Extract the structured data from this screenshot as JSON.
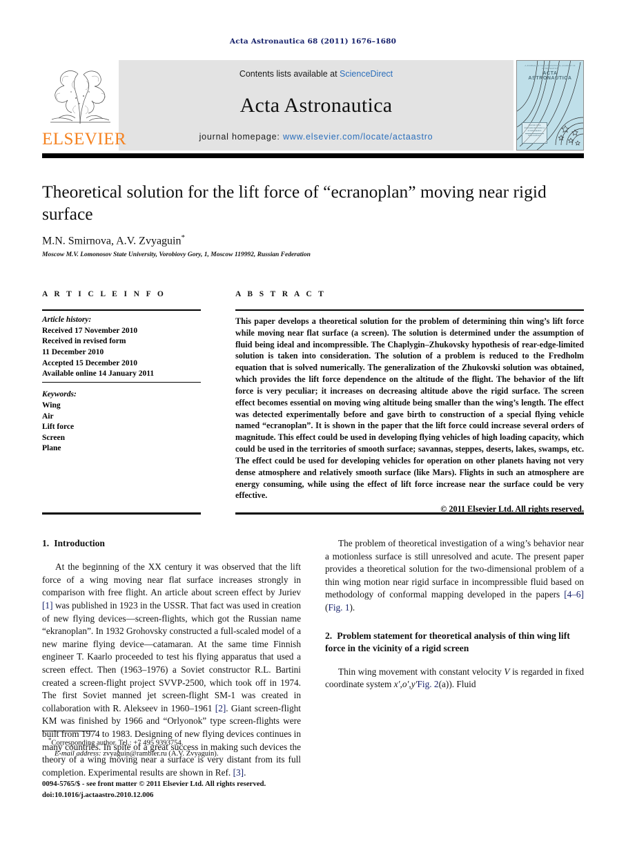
{
  "running_head": "Acta Astronautica 68 (2011) 1676–1680",
  "masthead": {
    "publisher_wordmark": "ELSEVIER",
    "contents_prefix": "Contents lists available at ",
    "contents_link": "ScienceDirect",
    "journal_name": "Acta Astronautica",
    "homepage_prefix": "journal homepage: ",
    "homepage_url": "www.elsevier.com/locate/actaastro",
    "cover": {
      "title": "ACTA ASTRONAUTICA",
      "top_line": "A JOURNAL OF THE INTERNATIONAL ACADEMY OF ASTRONAUTICS",
      "badge_line1": "Journal of the",
      "badge_line2": "International Academy",
      "badge_line3": "of Astronautics",
      "badge_line4": "ScienceDirect"
    }
  },
  "article": {
    "title": "Theoretical solution for the lift force of “ecranoplan” moving near rigid surface",
    "authors": "M.N. Smirnova, A.V. Zvyaguin",
    "corresponding_marker": "*",
    "affiliation": "Moscow M.V. Lomonosov State University, Vorobiovy Gory, 1, Moscow 119992, Russian Federation"
  },
  "article_info": {
    "heading": "A R T I C L E   I N F O",
    "history_label": "Article history:",
    "history_lines": [
      "Received 17 November 2010",
      "Received in revised form",
      "11 December 2010",
      "Accepted 15 December 2010",
      "Available online 14 January 2011"
    ],
    "keywords_label": "Keywords:",
    "keywords": [
      "Wing",
      "Air",
      "Lift force",
      "Screen",
      "Plane"
    ]
  },
  "abstract": {
    "heading": "A B S T R A C T",
    "text": "This paper develops a theoretical solution for the problem of determining thin wing’s lift force while moving near flat surface (a screen). The solution is determined under the assumption of fluid being ideal and incompressible. The Chaplygin–Zhukovsky hypothesis of rear-edge-limited solution is taken into consideration. The solution of a problem is reduced to the Fredholm equation that is solved numerically. The generalization of the Zhukovski solution was obtained, which provides the lift force dependence on the altitude of the flight. The behavior of the lift force is very peculiar; it increases on decreasing altitude above the rigid surface. The screen effect becomes essential on moving wing altitude being smaller than the wing’s length. The effect was detected experimentally before and gave birth to construction of a special flying vehicle named “ecranoplan”. It is shown in the paper that the lift force could increase several orders of magnitude. This effect could be used in developing flying vehicles of high loading capacity, which could be used in the territories of smooth surface; savannas, steppes, deserts, lakes, swamps, etc. The effect could be used for developing vehicles for operation on other planets having not very dense atmosphere and relatively smooth surface (like Mars). Flights in such an atmosphere are energy consuming, while using the effect of lift force increase near the surface could be very effective.",
    "copyright": "© 2011 Elsevier Ltd. All rights reserved."
  },
  "sections": {
    "intro": {
      "number": "1.",
      "title": "Introduction",
      "para1_part1": "At the beginning of the XX century it was observed that the lift force of a wing moving near flat surface increases strongly in comparison with free flight. An article about screen effect by Juriev ",
      "para1_ref1": "[1]",
      "para1_part2": " was published in 1923 in the USSR. That fact was used in creation of new flying devices—screen-flights, which got the Russian name “ekranoplan”. In 1932 Grohovsky constructed a full-scaled model of a new marine flying device—catamaran. At the same time Finnish engineer T. Kaarlo proceeded to test his flying apparatus that used a screen effect. Then (1963–1976) a Soviet constructor R.L. Bartini created a screen-flight project SVVP-2500, which took off in 1974. The first Soviet manned jet screen-flight SM-1 was created in collaboration with R. Alekseev in 1960–1961 ",
      "para1_ref2": "[2]",
      "para1_part3": ". Giant screen-flight KM was finished by 1966 and “Orlyonok” type screen-flights were built from 1974 to 1983. Designing of new flying devices continues in many countries. In spite of a great success in making such devices the theory of a wing moving near a surface is very distant from its full completion. Experimental results are shown in Ref. ",
      "para1_ref3": "[3]",
      "para1_part4": ".",
      "para2_part1": "The problem of theoretical investigation of a wing’s behavior near a motionless surface is still unresolved and acute. The present paper provides a theoretical solution for the two-dimensional problem of a thin wing motion near rigid surface in incompressible fluid based on methodology of conformal mapping developed in the papers ",
      "para2_ref1": "[4–6]",
      "para2_mid": " (",
      "para2_ref2": "Fig. 1",
      "para2_part2": ")."
    },
    "problem": {
      "number": "2.",
      "title": "Problem statement for theoretical analysis of thin wing lift force in the vicinity of a rigid screen",
      "para1_part1": "Thin wing movement with constant velocity ",
      "para1_var1": "V",
      "para1_part2": " is regarded in fixed coordinate system ",
      "para1_var2": "x′,o′,y′",
      "para1_ref": "Fig. 2",
      "para1_part3": "(a)). Fluid"
    }
  },
  "footnote": {
    "marker": "*",
    "corresponding": "Corresponding author. Tel.: +7 495 9393754.",
    "email_label": "E-mail address:",
    "email": " zvyaguin@rambler.ru (A.V. Zvyaguin)."
  },
  "issn_line1": "0094-5765/$ - see front matter © 2011 Elsevier Ltd. All rights reserved.",
  "issn_line2": "doi:10.1016/j.actaastro.2010.12.006",
  "colors": {
    "running_head": "#16216b",
    "link_blue": "#2a6ebb",
    "reference_blue": "#16216b",
    "elsevier_orange": "#f58220",
    "band_gray": "#e3e3e3",
    "cover_blue": "#bfdfe9"
  }
}
